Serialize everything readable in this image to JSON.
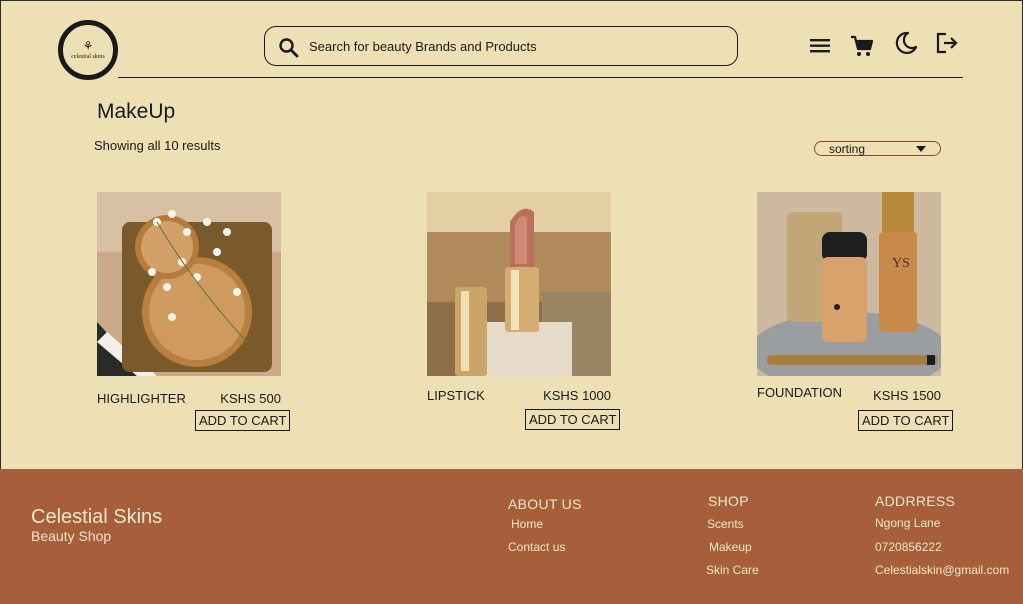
{
  "header": {
    "logo_text": "celestial skins",
    "search_placeholder": "Search for beauty Brands and Products"
  },
  "main": {
    "title": "MakeUp",
    "result_count": "Showing all 10 results",
    "sort_label": "sorting",
    "products": [
      {
        "name": "HIGHLIGHTER",
        "price": "KSHS 500",
        "button": "ADD TO CART"
      },
      {
        "name": "LIPSTICK",
        "price": "KSHS 1000",
        "button": "ADD TO CART"
      },
      {
        "name": "FOUNDATION",
        "price": "KSHS 1500",
        "button": "ADD TO CART"
      }
    ]
  },
  "footer": {
    "brand": "Celestial Skins",
    "tagline": "Beauty Shop",
    "about": {
      "heading": "ABOUT US",
      "links": [
        "Home",
        "Contact us"
      ]
    },
    "shop": {
      "heading": "SHOP",
      "links": [
        "Scents",
        "Makeup",
        "Skin Care"
      ]
    },
    "address": {
      "heading": "ADDRRESS",
      "lines": [
        "Ngong Lane",
        "0720856222",
        "Celestialskin@gmail.com"
      ]
    }
  }
}
